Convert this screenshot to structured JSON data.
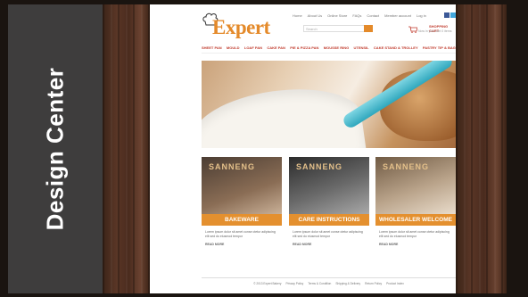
{
  "sidebar": {
    "title": "Design Center"
  },
  "site": {
    "logo_text": "Expert",
    "top_nav": [
      "Home",
      "About Us",
      "Online Store",
      "FAQs",
      "Contact",
      "Member account",
      "Log in"
    ],
    "social": [
      "facebook-icon",
      "twitter-icon"
    ],
    "search_placeholder": "Search",
    "cart_title": "SHOPPING CART",
    "cart_sub": "Now in your cart 0 items",
    "main_nav": [
      "SHEET PAN",
      "MOULD",
      "LOAF PAN",
      "CAKE PAN",
      "PIE & PIZZA PAN",
      "MOUSSE RING",
      "UTENSIL",
      "CAKE STAND & TROLLEY",
      "PASTRY TIP & BAG"
    ],
    "cards": [
      {
        "brand": "SANNENG",
        "label": "BAKEWARE",
        "desc": "Lorem ipsum dolor sit amet conse ctetur adipiscing elit sed do eiusmod tempor",
        "more": "READ MORE"
      },
      {
        "brand": "SANNENG",
        "label": "CARE INSTRUCTIONS",
        "desc": "Lorem ipsum dolor sit amet conse ctetur adipiscing elit sed do eiusmod tempor",
        "more": "READ MORE"
      },
      {
        "brand": "SANNENG",
        "label": "WHOLESALER WELCOME",
        "desc": "Lorem ipsum dolor sit amet conse ctetur adipiscing elit sed do eiusmod tempor",
        "more": "READ MORE"
      }
    ],
    "footer": [
      "© 2013 Expert Bakery",
      "Privacy Policy",
      "Terms & Condition",
      "Shipping & Delivery",
      "Return Policy",
      "Product Index"
    ]
  },
  "colors": {
    "accent": "#e48a2a",
    "nav": "#c0392b",
    "sidebar": "#3e3d3d"
  }
}
